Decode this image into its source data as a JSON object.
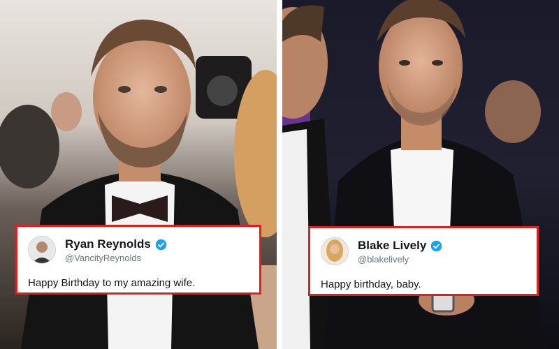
{
  "tweets": {
    "left": {
      "name": "Ryan Reynolds",
      "handle": "@VancityReynolds",
      "text": "Happy Birthday to my amazing wife."
    },
    "right": {
      "name": "Blake Lively",
      "handle": "@blakelively",
      "text": "Happy birthday, baby."
    }
  },
  "colors": {
    "highlight_border": "#e0201d",
    "verified_badge": "#1da1f2"
  },
  "icons": [
    "verified-badge-icon",
    "avatar-photo"
  ]
}
